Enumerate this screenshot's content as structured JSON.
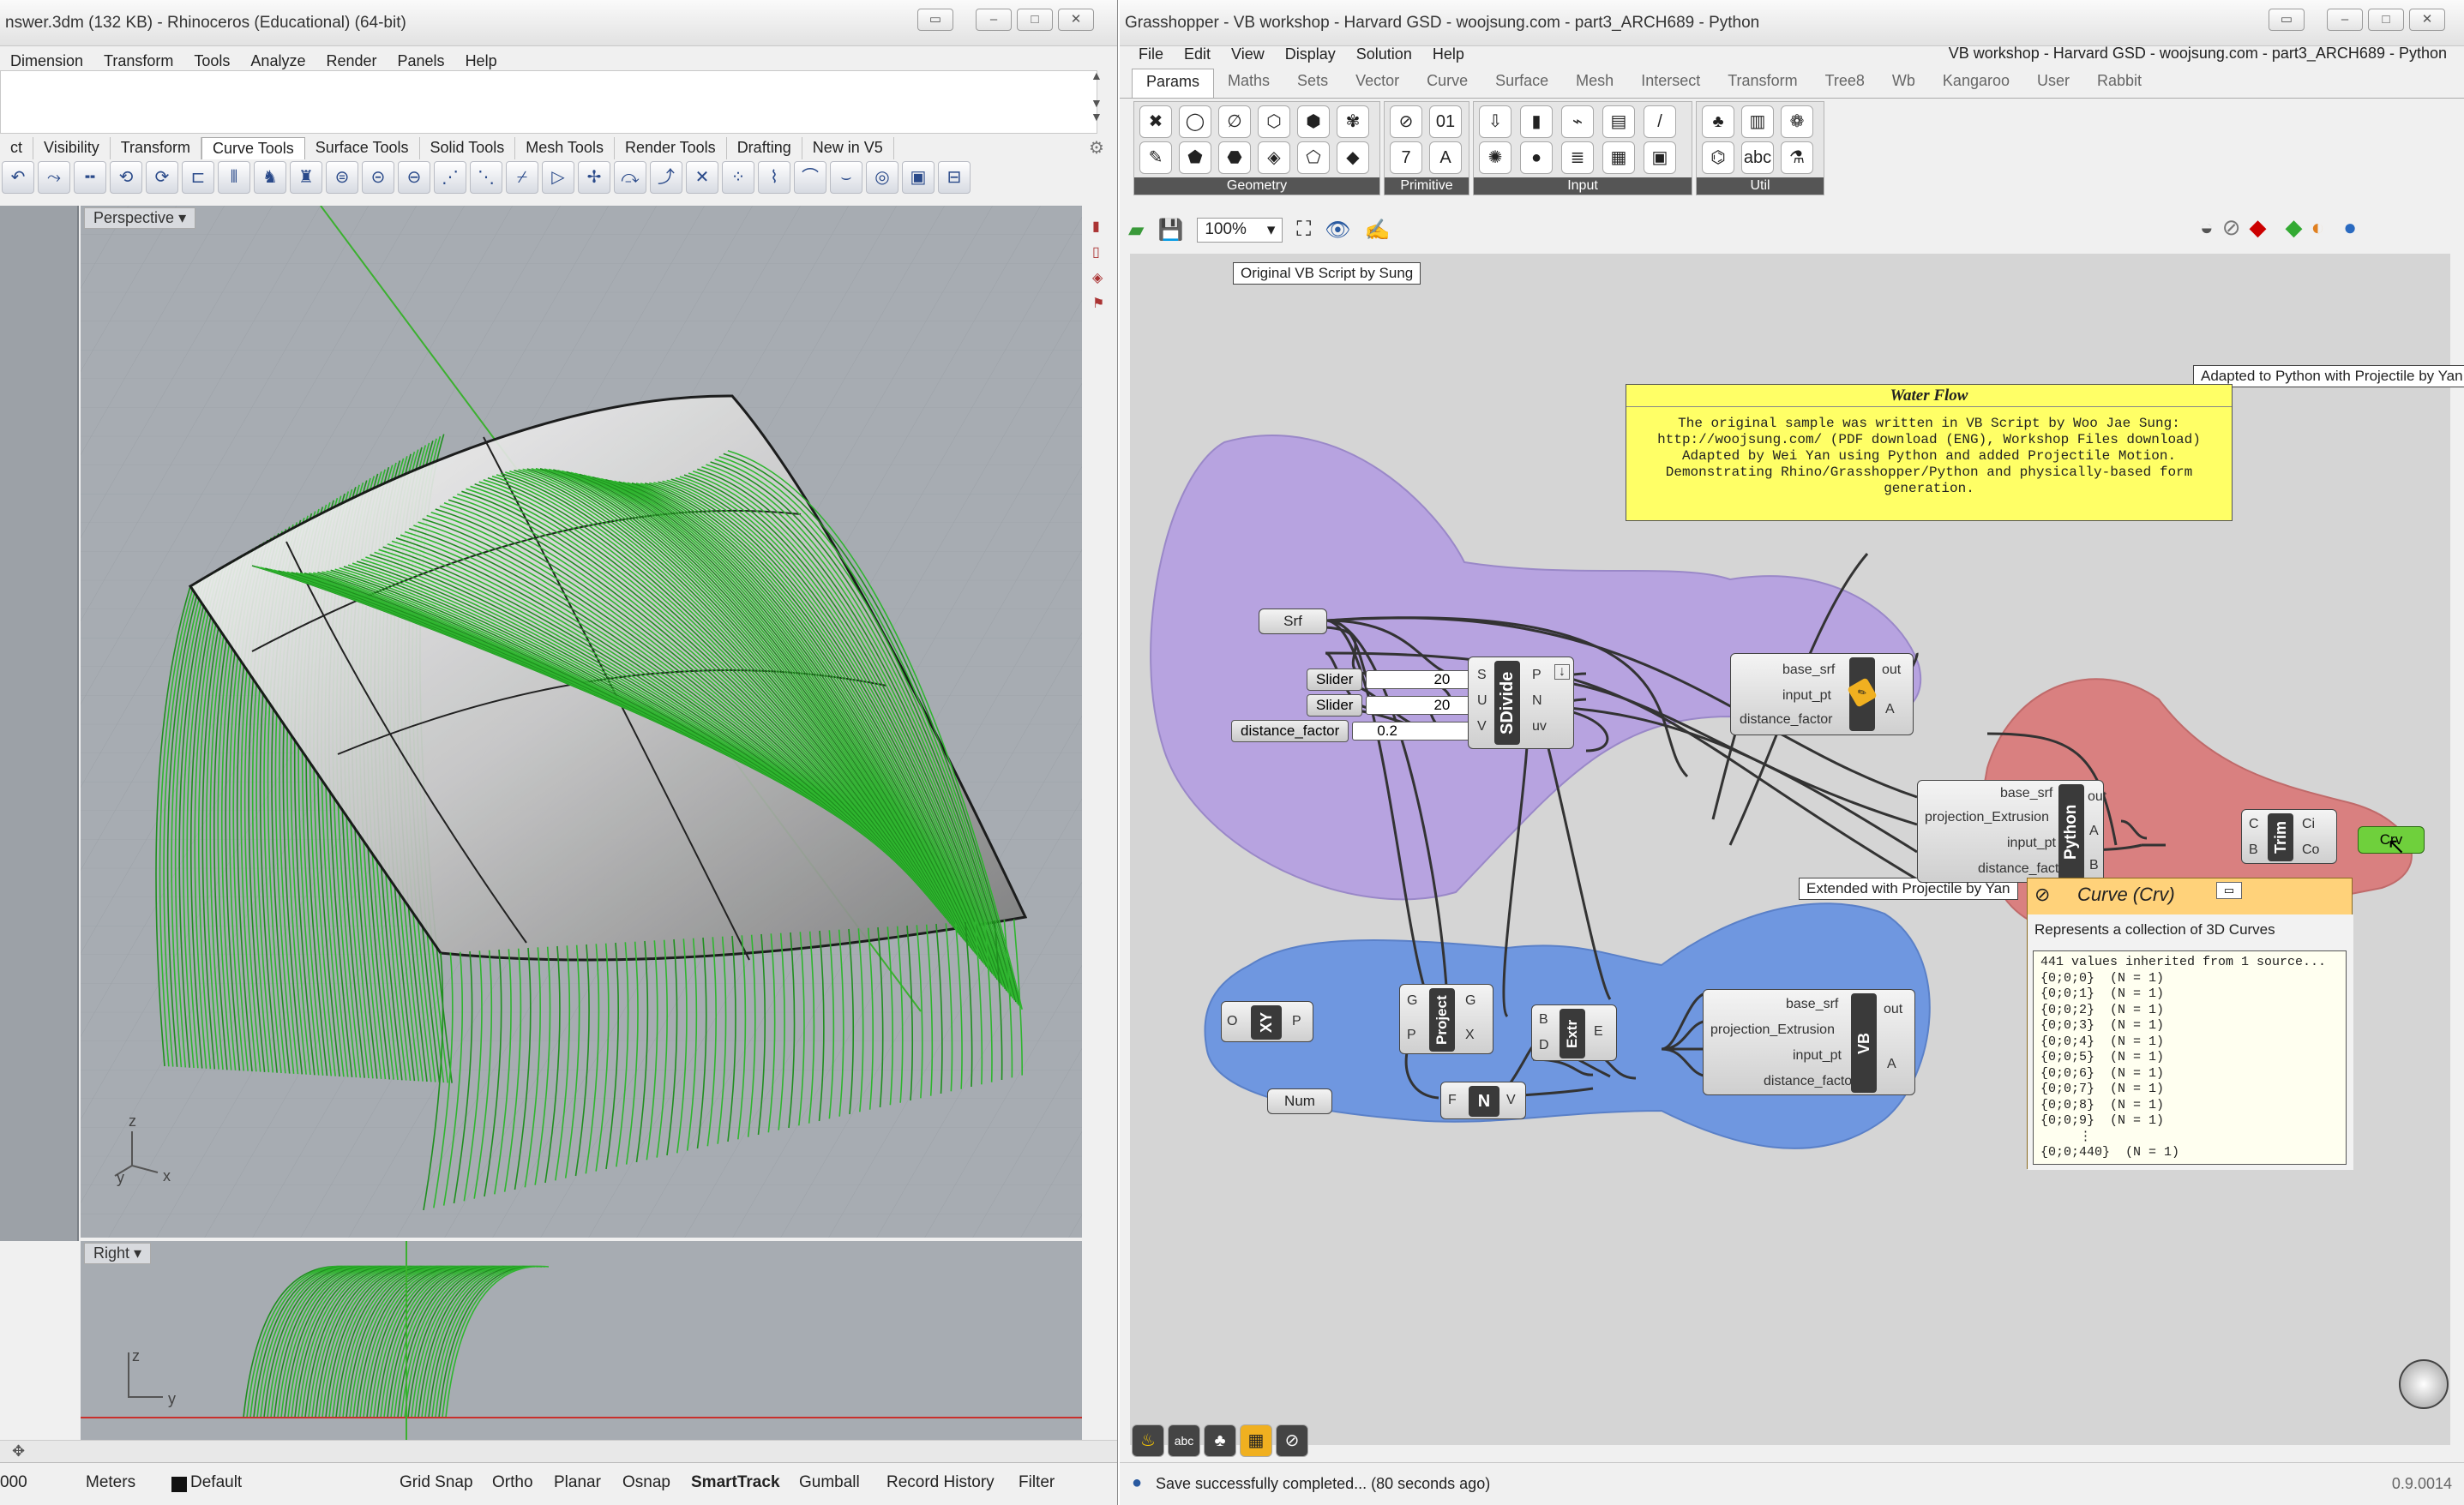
{
  "rhino": {
    "title": "nswer.3dm (132 KB) - Rhinoceros (Educational) (64-bit)",
    "menus": [
      "Dimension",
      "Transform",
      "Tools",
      "Analyze",
      "Render",
      "Panels",
      "Help"
    ],
    "tabs": [
      "ct",
      "Visibility",
      "Transform",
      "Curve Tools",
      "Surface Tools",
      "Solid Tools",
      "Mesh Tools",
      "Render Tools",
      "Drafting",
      "New in V5"
    ],
    "selected_tab": "Curve Tools",
    "viewport_perspective": "Perspective",
    "viewport_right": "Right",
    "status": {
      "coord": "000",
      "units": "Meters",
      "layer": "Default",
      "toggles": [
        "Grid Snap",
        "Ortho",
        "Planar",
        "Osnap",
        "SmartTrack",
        "Gumball",
        "Record History",
        "Filter"
      ]
    }
  },
  "gh": {
    "title": "Grasshopper - VB workshop - Harvard GSD - woojsung.com - part3_ARCH689 - Python",
    "doc_title": "VB workshop - Harvard GSD - woojsung.com - part3_ARCH689 - Python",
    "menus": [
      "File",
      "Edit",
      "View",
      "Display",
      "Solution",
      "Help"
    ],
    "tabs": [
      "Params",
      "Maths",
      "Sets",
      "Vector",
      "Curve",
      "Surface",
      "Mesh",
      "Intersect",
      "Transform",
      "Tree8",
      "Wb",
      "Kangaroo",
      "User",
      "Rabbit"
    ],
    "selected_tab": "Params",
    "groups": [
      "Geometry",
      "Primitive",
      "Input",
      "Util"
    ],
    "zoom": "100%",
    "note": {
      "title": "Water Flow",
      "lines": [
        "The original sample was written in VB Script by Woo Jae Sung:",
        "http://woojsung.com/ (PDF download (ENG), Workshop Files download)",
        "Adapted by Wei Yan using Python and added Projectile Motion.",
        "Demonstrating Rhino/Grasshopper/Python and physically-based form",
        "generation."
      ]
    },
    "group_labels": {
      "purple": "Original VB Script by Sung",
      "red": "Adapted to Python with Projectile by Yan",
      "blue": "Extended with Projectile by Yan"
    },
    "components": {
      "srf": "Srf",
      "slider1_name": "Slider",
      "slider1_value": "20",
      "slider2_name": "Slider",
      "slider2_value": "20",
      "slider3_name": "distance_factor",
      "slider3_value": "0.2",
      "sdivide": "SDivide",
      "sdivide_in": [
        "S",
        "U",
        "V"
      ],
      "sdivide_out": [
        "P",
        "N",
        "uv"
      ],
      "vb_in": [
        "base_srf",
        "input_pt",
        "distance_factor"
      ],
      "vb_out": [
        "out",
        "A"
      ],
      "python": "Python",
      "py_in": [
        "base_srf",
        "projection_Extrusion",
        "input_pt",
        "distance_factor"
      ],
      "py_out": [
        "out",
        "A",
        "B"
      ],
      "trim": "Trim",
      "trim_in": [
        "C",
        "B"
      ],
      "trim_out": [
        "Ci",
        "Co"
      ],
      "crv": "Crv",
      "xy": "XY",
      "xy_in": "O",
      "xy_out": "P",
      "project": "Project",
      "project_in": [
        "G",
        "P"
      ],
      "project_out": [
        "G",
        "X"
      ],
      "extr": "Extr",
      "extr_in": [
        "B",
        "D"
      ],
      "extr_out": "E",
      "vb2": "VB",
      "vb2_in": [
        "base_srf",
        "projection_Extrusion",
        "input_pt",
        "distance_factor"
      ],
      "vb2_out": [
        "out",
        "A"
      ],
      "num": "Num",
      "neg": "N",
      "neg_in": "F",
      "neg_out": "V"
    },
    "tooltip": {
      "title": "Curve (Crv)",
      "desc": "Represents a collection of 3D Curves",
      "data": "441 values inherited from 1 source...\n{0;0;0}  (N = 1)\n{0;0;1}  (N = 1)\n{0;0;2}  (N = 1)\n{0;0;3}  (N = 1)\n{0;0;4}  (N = 1)\n{0;0;5}  (N = 1)\n{0;0;6}  (N = 1)\n{0;0;7}  (N = 1)\n{0;0;8}  (N = 1)\n{0;0;9}  (N = 1)\n     ⋮\n{0;0;440}  (N = 1)"
    },
    "status": "Save successfully completed... (80 seconds ago)",
    "version": "0.9.0014"
  }
}
